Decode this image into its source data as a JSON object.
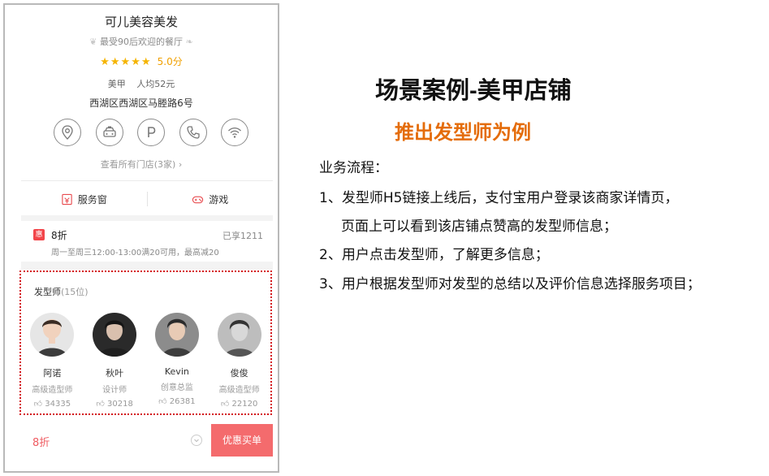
{
  "shop": {
    "name": "可儿美容美发",
    "slogan": "最受90后欢迎的餐厅",
    "stars": "★★★★★",
    "score": "5.0分",
    "category": "美甲",
    "avg_price": "人均52元",
    "address": "西湖区西湖区马塍路6号",
    "view_stores": "查看所有门店(3家)",
    "icons": [
      "location-icon",
      "taxi-icon",
      "parking-icon",
      "phone-icon",
      "wifi-icon"
    ]
  },
  "tabs": [
    {
      "label": "服务窗",
      "icon": "service-window-icon"
    },
    {
      "label": "游戏",
      "icon": "gamepad-icon"
    }
  ],
  "discount": {
    "badge": "惠",
    "title": "8折",
    "used": "已享1211",
    "desc": "周一至周三12:00-13:00满20可用，最高减20"
  },
  "stylists_section": {
    "title": "发型师",
    "count": "(15位)",
    "items": [
      {
        "name": "阿诺",
        "role": "高级造型师",
        "likes": "34335"
      },
      {
        "name": "秋叶",
        "role": "设计师",
        "likes": "30218"
      },
      {
        "name": "Kevin",
        "role": "创意总监",
        "likes": "26381"
      },
      {
        "name": "俊俊",
        "role": "高级造型师",
        "likes": "22120"
      }
    ]
  },
  "bottom": {
    "discount": "8折",
    "buy_label": "优惠买单"
  },
  "colors": {
    "accent_orange": "#e46c0a",
    "star": "#f5b400",
    "buy_button": "#f46b6d",
    "dotted_border": "#d4161c"
  },
  "right": {
    "title": "场景案例-美甲店铺",
    "subtitle": "推出发型师为例",
    "flow_label": "业务流程：",
    "lines": [
      "1、发型师H5链接上线后，支付宝用户登录该商家详情页，",
      "页面上可以看到该店铺点赞高的发型师信息；",
      "2、用户点击发型师，了解更多信息；",
      "3、用户根据发型师对发型的总结以及评价信息选择服务项目；"
    ]
  }
}
